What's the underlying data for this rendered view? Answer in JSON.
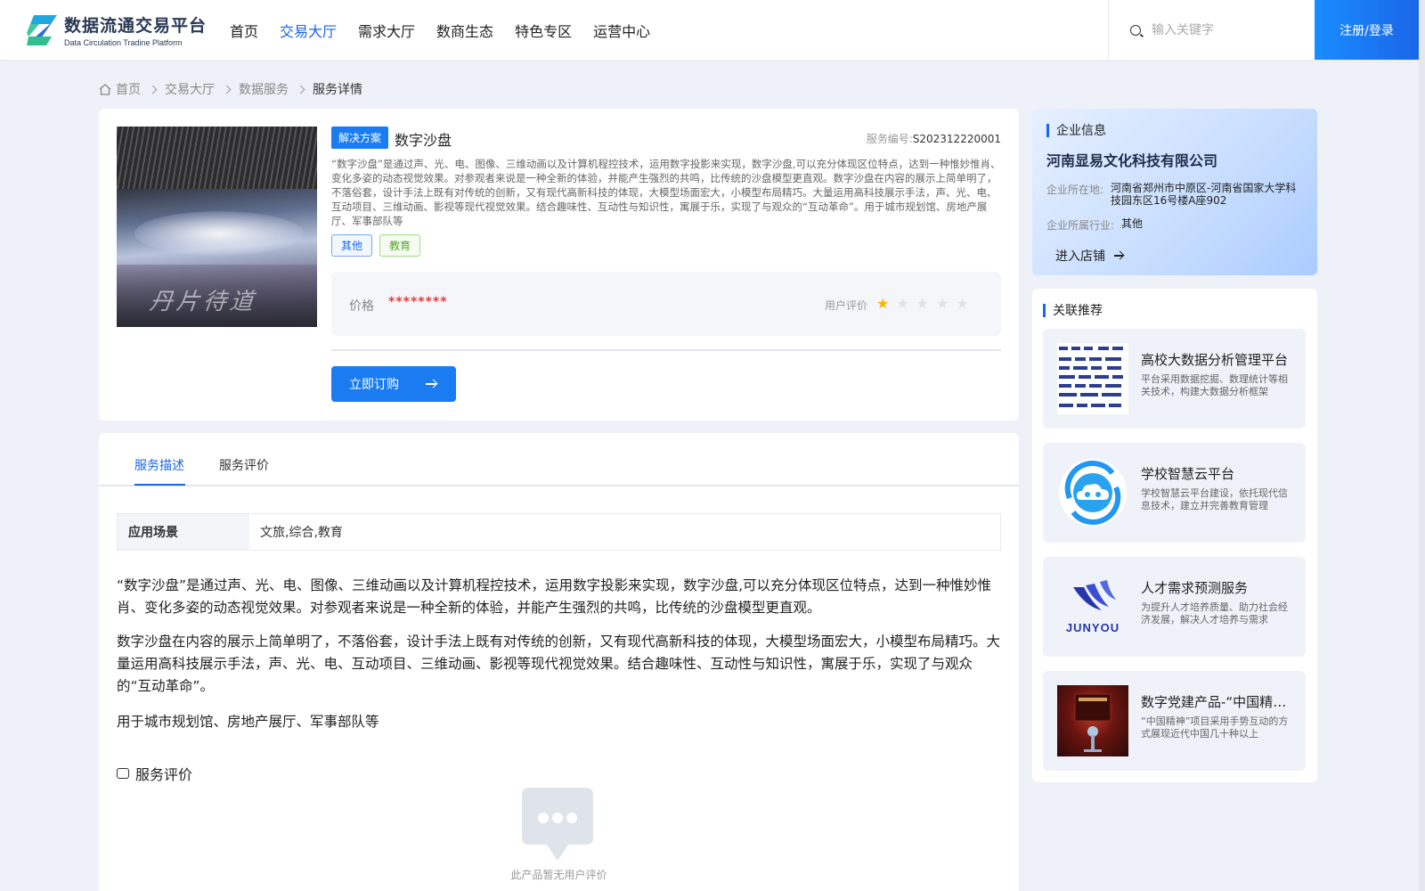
{
  "header": {
    "logo_title": "数据流通交易平台",
    "logo_subtitle": "Data Circulation Tradine Platform",
    "nav": [
      {
        "label": "首页",
        "active": false
      },
      {
        "label": "交易大厅",
        "active": true
      },
      {
        "label": "需求大厅",
        "active": false
      },
      {
        "label": "数商生态",
        "active": false
      },
      {
        "label": "特色专区",
        "active": false
      },
      {
        "label": "运营中心",
        "active": false
      }
    ],
    "search_placeholder": "输入关键字",
    "login_label": "注册/登录",
    "accent_color": "#1a66e8"
  },
  "breadcrumb": [
    "首页",
    "交易大厅",
    "数据服务",
    "服务详情"
  ],
  "product": {
    "type_tag": "解决方案",
    "title": "数字沙盘",
    "service_no_label": "服务编号:",
    "service_no": "S202312220001",
    "description": "“数字沙盘”是通过声、光、电、图像、三维动画以及计算机程控技术，运用数字投影来实现，数字沙盘,可以充分体现区位特点，达到一种惟妙惟肖、变化多姿的动态视觉效果。对参观者来说是一种全新的体验，并能产生强烈的共鸣，比传统的沙盘模型更直观。数字沙盘在内容的展示上简单明了，不落俗套，设计手法上既有对传统的创新，又有现代高新科技的体现，大模型场面宏大，小模型布局精巧。大量运用高科技展示手法，声、光、电、互动项目、三维动画、影视等现代视觉效果。结合趣味性、互动性与知识性，寓展于乐，实现了与观众的“互动革命”。用于城市规划馆、房地产展厅、军事部队等",
    "tags": [
      "其他",
      "教育"
    ],
    "image_text": "丹片待道",
    "price_label": "价格",
    "price_value": "********",
    "rating_label": "用户评价",
    "rating": 1,
    "rating_max": 5,
    "order_label": "立即订购"
  },
  "detail": {
    "tabs": [
      {
        "label": "服务描述",
        "active": true
      },
      {
        "label": "服务评价",
        "active": false
      }
    ],
    "scene_label": "应用场景",
    "scene_value": "文旅,综合,教育",
    "paragraphs": [
      "“数字沙盘”是通过声、光、电、图像、三维动画以及计算机程控技术，运用数字投影来实现，数字沙盘,可以充分体现区位特点，达到一种惟妙惟肖、变化多姿的动态视觉效果。对参观者来说是一种全新的体验，并能产生强烈的共鸣，比传统的沙盘模型更直观。",
      "数字沙盘在内容的展示上简单明了，不落俗套，设计手法上既有对传统的创新，又有现代高新科技的体现，大模型场面宏大，小模型布局精巧。大量运用高科技展示手法，声、光、电、互动项目、三维动画、影视等现代视觉效果。结合趣味性、互动性与知识性，寓展于乐，实现了与观众的“互动革命”。",
      "用于城市规划馆、房地产展厅、军事部队等"
    ],
    "review_title": "服务评价",
    "empty_text": "此产品暂无用户评价"
  },
  "company": {
    "section_title": "企业信息",
    "name": "河南显易文化科技有限公司",
    "location_label": "企业所在地:",
    "location": "河南省郑州市中原区-河南省国家大学科技园东区16号楼A座902",
    "industry_label": "企业所属行业:",
    "industry": "其他",
    "shop_label": "进入店铺"
  },
  "recommend": {
    "section_title": "关联推荐",
    "items": [
      {
        "title": "高校大数据分析管理平台",
        "desc": "平台采用数据挖掘、数理统计等相关技术，构建大数据分析框架",
        "thumb": "diagram"
      },
      {
        "title": "学校智慧云平台",
        "desc": "学校智慧云平台建设，依托现代信息技术，建立并完善教育管理",
        "thumb": "cloud"
      },
      {
        "title": "人才需求预测服务",
        "desc": "为提升人才培养质量、助力社会经济发展，解决人才培养与需求",
        "thumb": "junyou",
        "thumb_text": "JUNYOU"
      },
      {
        "title": "数字党建产品-“中国精神”",
        "desc": "“中国精神”项目采用手势互动的方式展现近代中国几十种以上",
        "thumb": "room"
      }
    ]
  }
}
